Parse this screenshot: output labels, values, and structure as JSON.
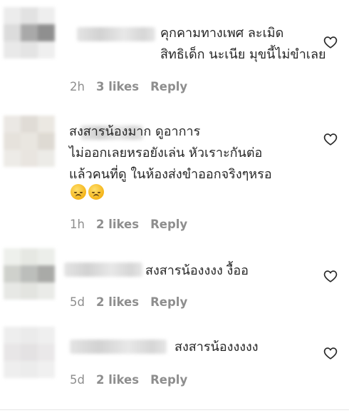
{
  "comments": [
    {
      "text": "คุกคามทางเพศ ละเมิด\nสิทธิเด็ก นะเนีย มุขนี้ไม่ขำเลย",
      "time": "2h",
      "likes": "3 likes",
      "reply": "Reply",
      "emojis": []
    },
    {
      "text": "สงสารน้องมาก ดูอาการ\nไม่ออกเลยหรอยังเล่น หัวเราะกันต่อ\nแล้วคนที่ดู ในห้องส่งขำออกจริงๆหรอ",
      "time": "1h",
      "likes": "2 likes",
      "reply": "Reply",
      "emojis": [
        "disappointed-face",
        "disappointed-face"
      ]
    },
    {
      "text": "สงสารน้องงงง งื้ออ",
      "time": "5d",
      "likes": "2 likes",
      "reply": "Reply",
      "emojis": []
    },
    {
      "text": "สงสารน้องงงงง",
      "time": "5d",
      "likes": "2 likes",
      "reply": "Reply",
      "emojis": []
    }
  ],
  "icons": {
    "like": "heart-outline-icon",
    "avatar": "blurred-avatar",
    "emoji": "disappointed-face-emoji"
  },
  "colors": {
    "text": "#262626",
    "meta": "#8e8e8e",
    "background": "#ffffff"
  }
}
